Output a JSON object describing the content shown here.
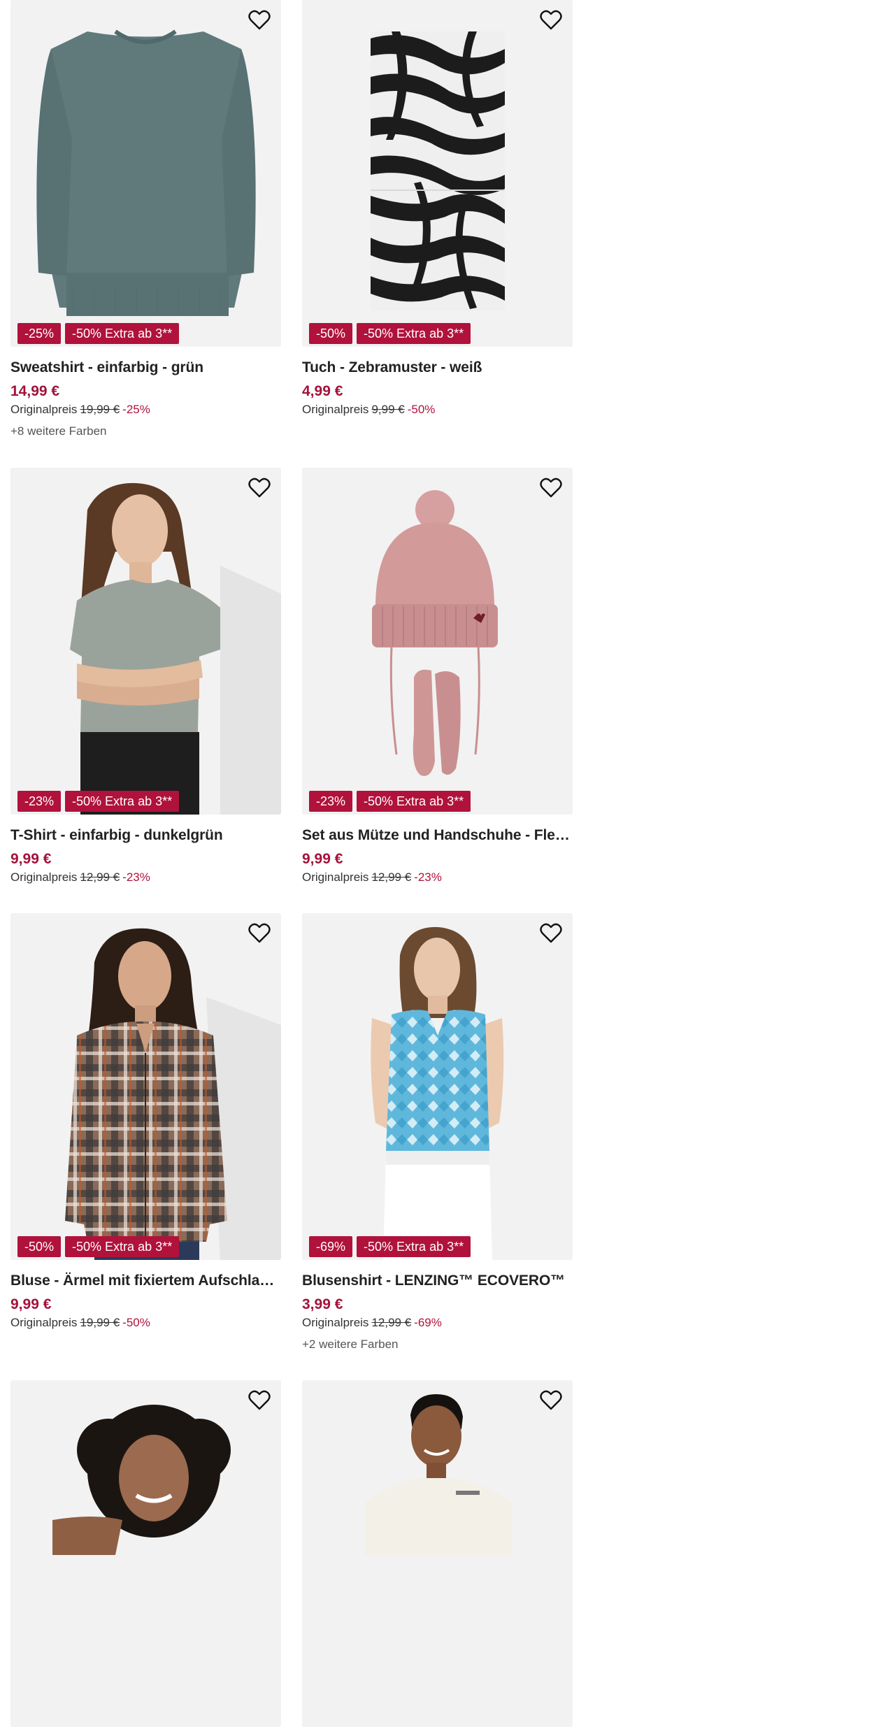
{
  "products": [
    {
      "title": "Sweatshirt - einfarbig - grün",
      "price": "14,99 €",
      "orig_label": "Originalpreis",
      "orig_price": "19,99 €",
      "orig_pct": "-25%",
      "colors": "+8 weitere Farben",
      "badges": [
        "-25%",
        "-50% Extra ab 3**"
      ],
      "image": "green-sweatshirt"
    },
    {
      "title": "Tuch - Zebramuster - weiß",
      "price": "4,99 €",
      "orig_label": "Originalpreis",
      "orig_price": "9,99 €",
      "orig_pct": "-50%",
      "colors": "",
      "badges": [
        "-50%",
        "-50% Extra ab 3**"
      ],
      "image": "zebra-scarf"
    },
    {
      "title": "T-Shirt - einfarbig - dunkelgrün",
      "price": "9,99 €",
      "orig_label": "Originalpreis",
      "orig_price": "12,99 €",
      "orig_pct": "-23%",
      "colors": "",
      "badges": [
        "-23%",
        "-50% Extra ab 3**"
      ],
      "image": "woman-grey-tshirt"
    },
    {
      "title": "Set aus Mütze und Handschuhe - Fleecef...",
      "price": "9,99 €",
      "orig_label": "Originalpreis",
      "orig_price": "12,99 €",
      "orig_pct": "-23%",
      "colors": "",
      "badges": [
        "-23%",
        "-50% Extra ab 3**"
      ],
      "image": "pink-hat-mittens"
    },
    {
      "title": "Bluse - Ärmel mit fixiertem Aufschlag - s...",
      "price": "9,99 €",
      "orig_label": "Originalpreis",
      "orig_price": "19,99 €",
      "orig_pct": "-50%",
      "colors": "",
      "badges": [
        "-50%",
        "-50% Extra ab 3**"
      ],
      "image": "woman-plaid-blouse"
    },
    {
      "title": "Blusenshirt - LENZING™ ECOVERO™",
      "price": "3,99 €",
      "orig_label": "Originalpreis",
      "orig_price": "12,99 €",
      "orig_pct": "-69%",
      "colors": "+2 weitere Farben",
      "badges": [
        "-69%",
        "-50% Extra ab 3**"
      ],
      "image": "woman-blue-top"
    },
    {
      "title": "",
      "price": "",
      "orig_label": "",
      "orig_price": "",
      "orig_pct": "",
      "colors": "",
      "badges": [],
      "image": "woman-curly-hair"
    },
    {
      "title": "",
      "price": "",
      "orig_label": "",
      "orig_price": "",
      "orig_pct": "",
      "colors": "",
      "badges": [],
      "image": "man-white-tshirt"
    }
  ],
  "icons": {
    "wishlist": "heart-outline-icon"
  },
  "colors": {
    "accent": "#b0123b",
    "price": "#a3123a",
    "image_bg": "#f2f2f2"
  }
}
